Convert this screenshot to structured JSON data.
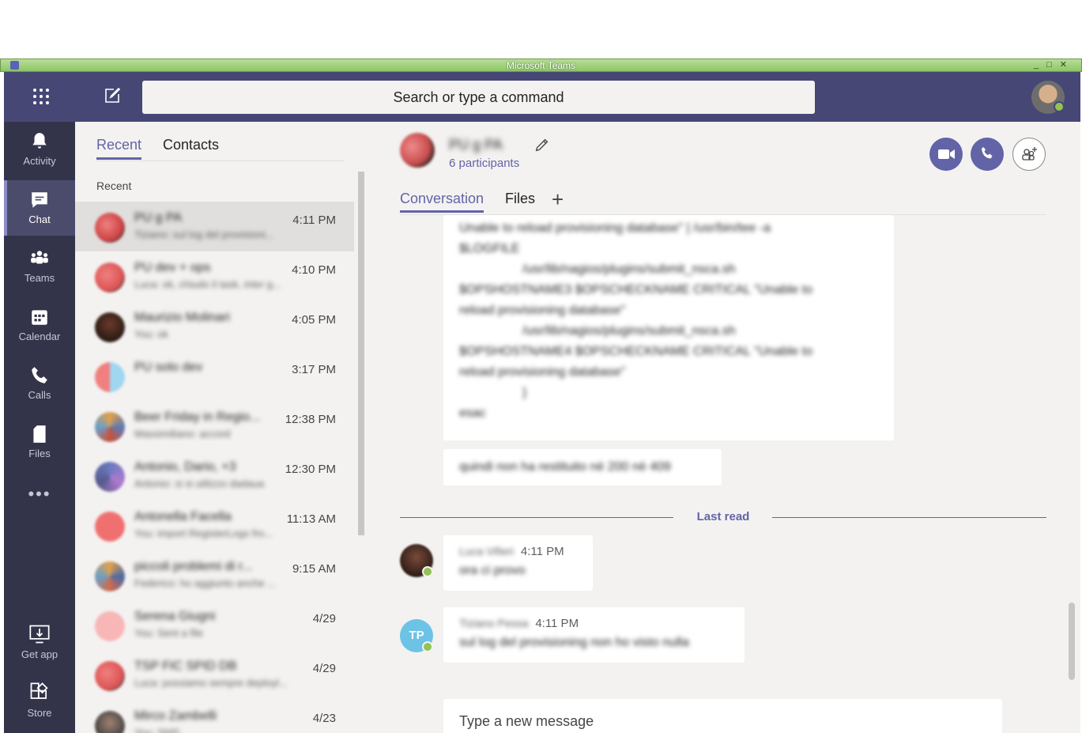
{
  "window": {
    "title": "Microsoft Teams",
    "controls": [
      "_",
      "□",
      "✕"
    ]
  },
  "header": {
    "search_placeholder": "Search or type a command",
    "icons": {
      "apps": "waffle-icon",
      "compose": "compose-icon"
    }
  },
  "rail": {
    "items": [
      {
        "label": "Activity",
        "icon": "bell-icon"
      },
      {
        "label": "Chat",
        "icon": "chat-icon"
      },
      {
        "label": "Teams",
        "icon": "teams-icon"
      },
      {
        "label": "Calendar",
        "icon": "calendar-icon"
      },
      {
        "label": "Calls",
        "icon": "phone-icon"
      },
      {
        "label": "Files",
        "icon": "file-icon"
      },
      {
        "label": "Get app",
        "icon": "download-icon"
      },
      {
        "label": "Store",
        "icon": "store-icon"
      }
    ],
    "more": "•••"
  },
  "left_pane": {
    "tabs": [
      "Recent",
      "Contacts"
    ],
    "section_label": "Recent",
    "chats": [
      {
        "name": "PU g PA",
        "preview": "Tiziano: sul log del provisioni...",
        "time": "4:11 PM"
      },
      {
        "name": "PU dev + ops",
        "preview": "Luca: ok, chiudo il task, inter g...",
        "time": "4:10 PM"
      },
      {
        "name": "Maurizio Molinari",
        "preview": "You: ok",
        "time": "4:05 PM"
      },
      {
        "name": "PU solo dev",
        "preview": "",
        "time": "3:17 PM"
      },
      {
        "name": "Beer Friday in Regio...",
        "preview": "Massimiliano: accord",
        "time": "12:38 PM"
      },
      {
        "name": "Antonio, Dario, +3",
        "preview": "Antonio: si si utilizzo dadaua",
        "time": "12:30 PM"
      },
      {
        "name": "Antonella Facella",
        "preview": "You: import RegisterLogs fro...",
        "time": "11:13 AM"
      },
      {
        "name": "piccoli problemi di r...",
        "preview": "Federico: ho aggiunto anche ...",
        "time": "9:15 AM"
      },
      {
        "name": "Serena Giugni",
        "preview": "You: Sent a file",
        "time": "4/29"
      },
      {
        "name": "TSP FIC SPID DB",
        "preview": "Luca: possiamo sempre deployl...",
        "time": "4/29"
      },
      {
        "name": "Mirco Zambelli",
        "preview": "You: SMS",
        "time": "4/23"
      }
    ]
  },
  "conversation": {
    "group_name": "PU g PA",
    "participants": "6 participants",
    "tabs": [
      "Conversation",
      "Files"
    ],
    "add_tab": "+",
    "code_lines": [
      "Unable to reload provisioning database\" | /usr/bin/tee -a",
      "$LOGFILE",
      "/usr/lib/nagios/plugins/submit_nsca.sh",
      "$OPSHOSTNAME3 $OPSCHECKNAME CRITICAL \"Unable to",
      "reload provisioning database\"",
      "/usr/lib/nagios/plugins/submit_nsca.sh",
      "$OPSHOSTNAME4 $OPSCHECKNAME CRITICAL \"Unable to",
      "reload provisioning database\"",
      "}",
      "esac"
    ],
    "followup": "quindi non ha restituito nè 200 nè 409",
    "last_read": "Last read",
    "messages": [
      {
        "sender": "Luca Vifieri",
        "time": "4:11 PM",
        "text": "ora ci provo",
        "initials": ""
      },
      {
        "sender": "Tiziano Pessa",
        "time": "4:11 PM",
        "text": "sul log del provisioning non ho visto nulla",
        "initials": "TP"
      }
    ],
    "composer_placeholder": "Type a new message"
  },
  "colors": {
    "brand": "#464775",
    "accent": "#6264a7",
    "rail": "#33344a",
    "presence": "#92c353"
  }
}
